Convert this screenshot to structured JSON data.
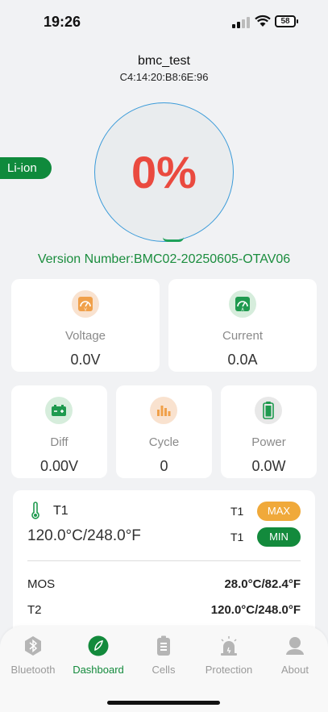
{
  "status_bar": {
    "time": "19:26",
    "battery": "58"
  },
  "device": {
    "name": "bmc_test",
    "mac": "C4:14:20:B8:6E:96"
  },
  "soc": {
    "value": "0%",
    "percent": 0
  },
  "chemistry_badge": "Li-ion",
  "version": "Version Number:BMC02-20250605-OTAV06",
  "metrics": [
    {
      "label": "Voltage",
      "value": "0.0V",
      "icon": "voltage-gauge-icon"
    },
    {
      "label": "Current",
      "value": "0.0A",
      "icon": "current-gauge-icon"
    },
    {
      "label": "Diff",
      "value": "0.00V",
      "icon": "battery-diff-icon"
    },
    {
      "label": "Cycle",
      "value": "0",
      "icon": "cycle-bars-icon"
    },
    {
      "label": "Power",
      "value": "0.0W",
      "icon": "battery-power-icon"
    }
  ],
  "temperature": {
    "sensor": "T1",
    "reading": "120.0°C/248.0°F",
    "max_sensor": "T1",
    "max_label": "MAX",
    "min_sensor": "T1",
    "min_label": "MIN",
    "rows": [
      {
        "label": "MOS",
        "value": "28.0°C/82.4°F"
      },
      {
        "label": "T2",
        "value": "120.0°C/248.0°F"
      }
    ]
  },
  "tabs": [
    {
      "label": "Bluetooth",
      "icon": "bluetooth-icon",
      "active": false
    },
    {
      "label": "Dashboard",
      "icon": "dashboard-icon",
      "active": true
    },
    {
      "label": "Cells",
      "icon": "battery-cells-icon",
      "active": false
    },
    {
      "label": "Protection",
      "icon": "alarm-light-icon",
      "active": false
    },
    {
      "label": "About",
      "icon": "user-icon",
      "active": false
    }
  ],
  "colors": {
    "accent": "#138a3c",
    "soc_text": "#ea4a3f",
    "ring": "#3b9bd9",
    "max_pill": "#f0a93a"
  }
}
